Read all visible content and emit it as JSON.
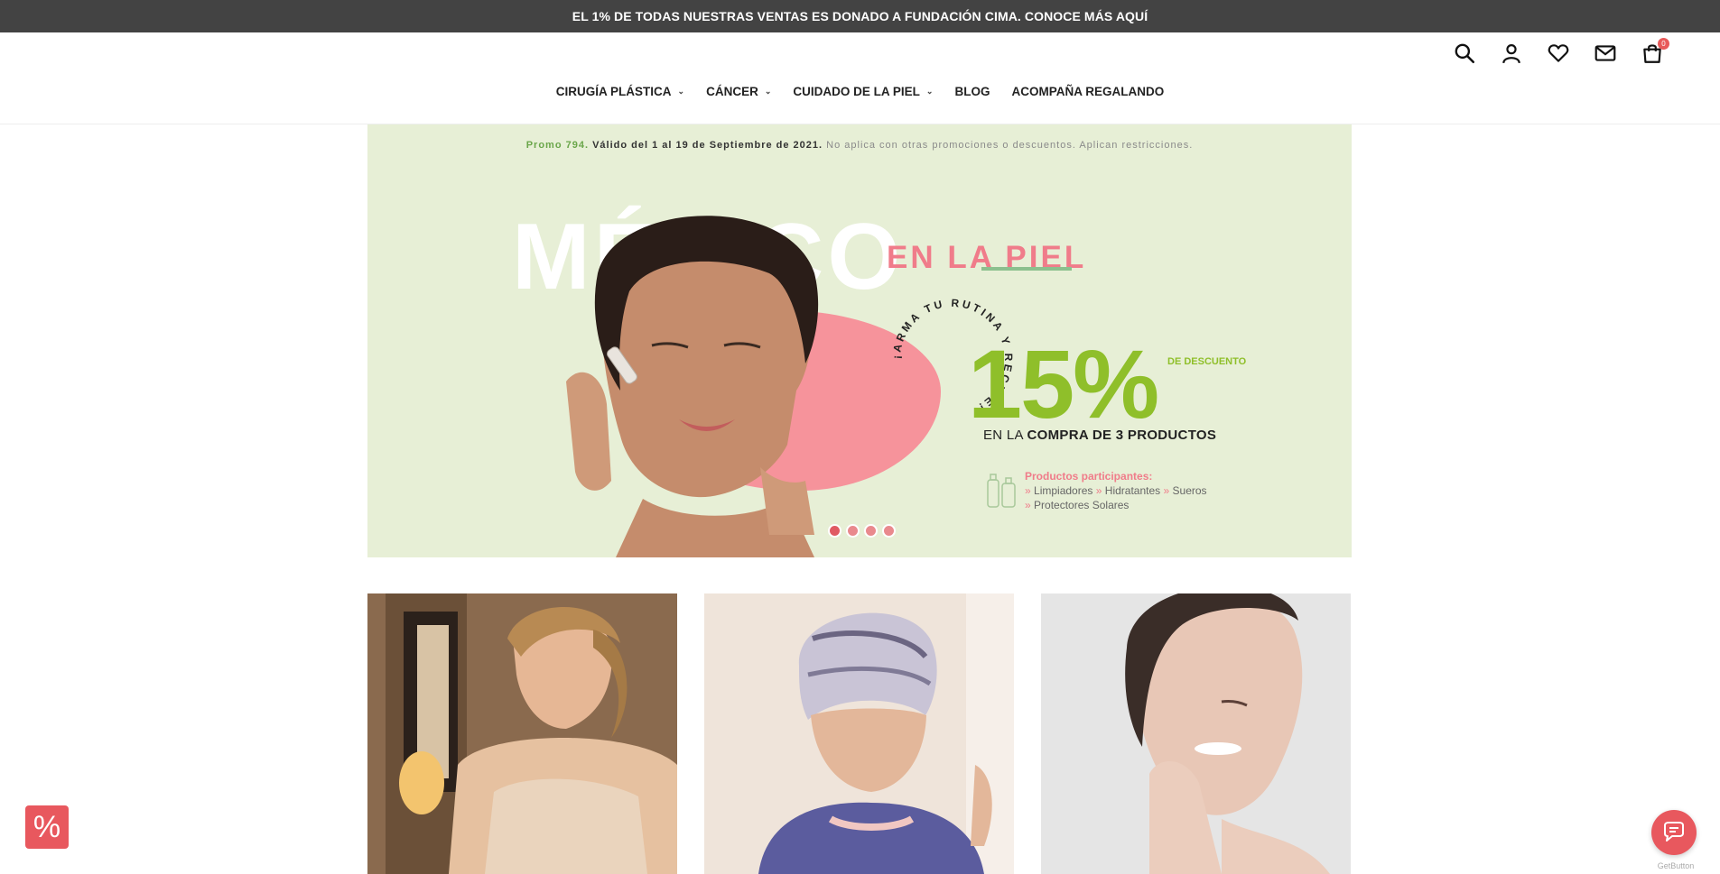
{
  "announcement": "EL 1% DE TODAS NUESTRAS VENTAS ES DONADO A FUNDACIÓN CIMA. CONOCE MÁS AQUÍ",
  "header": {
    "icons": [
      "search-icon",
      "user-icon",
      "heart-icon",
      "mail-icon",
      "cart-icon"
    ],
    "cart_count": "0"
  },
  "nav": [
    {
      "label": "CIRUGÍA PLÁSTICA",
      "dropdown": true
    },
    {
      "label": "CÁNCER",
      "dropdown": true
    },
    {
      "label": "CUIDADO DE LA PIEL",
      "dropdown": true
    },
    {
      "label": "BLOG",
      "dropdown": false
    },
    {
      "label": "ACOMPAÑA REGALANDO",
      "dropdown": false
    }
  ],
  "banner": {
    "promo_code": "Promo 794.",
    "promo_valid": "Válido del 1 al 19 de Septiembre de 2021.",
    "promo_note": "No aplica con otras promociones o descuentos. Aplican restricciones.",
    "headline": "MÉXICO",
    "headline_accent": "EN LA PIEL",
    "arc_text": "¡ARMA TU RUTINA Y RECIBE!",
    "percent": "15%",
    "percent_label": "DE DESCUENTO",
    "compra_prefix": "EN LA",
    "compra_bold": "COMPRA DE 3 PRODUCTOS",
    "products_title": "Productos participantes:",
    "products_line1_a": "Limpiadores",
    "products_line1_b": "Hidratantes",
    "products_line1_c": "Sueros",
    "products_line2": "Protectores Solares",
    "bullet": "»",
    "slides": 4,
    "active_slide": 1
  },
  "floating": {
    "discount_symbol": "%",
    "getbutton_label": "GetButton"
  },
  "colors": {
    "accent": "#e8585e",
    "announcement_bg": "#434343",
    "banner_bg": "#e7efd6",
    "green": "#8fbf2a",
    "pink": "#f07c8a"
  }
}
